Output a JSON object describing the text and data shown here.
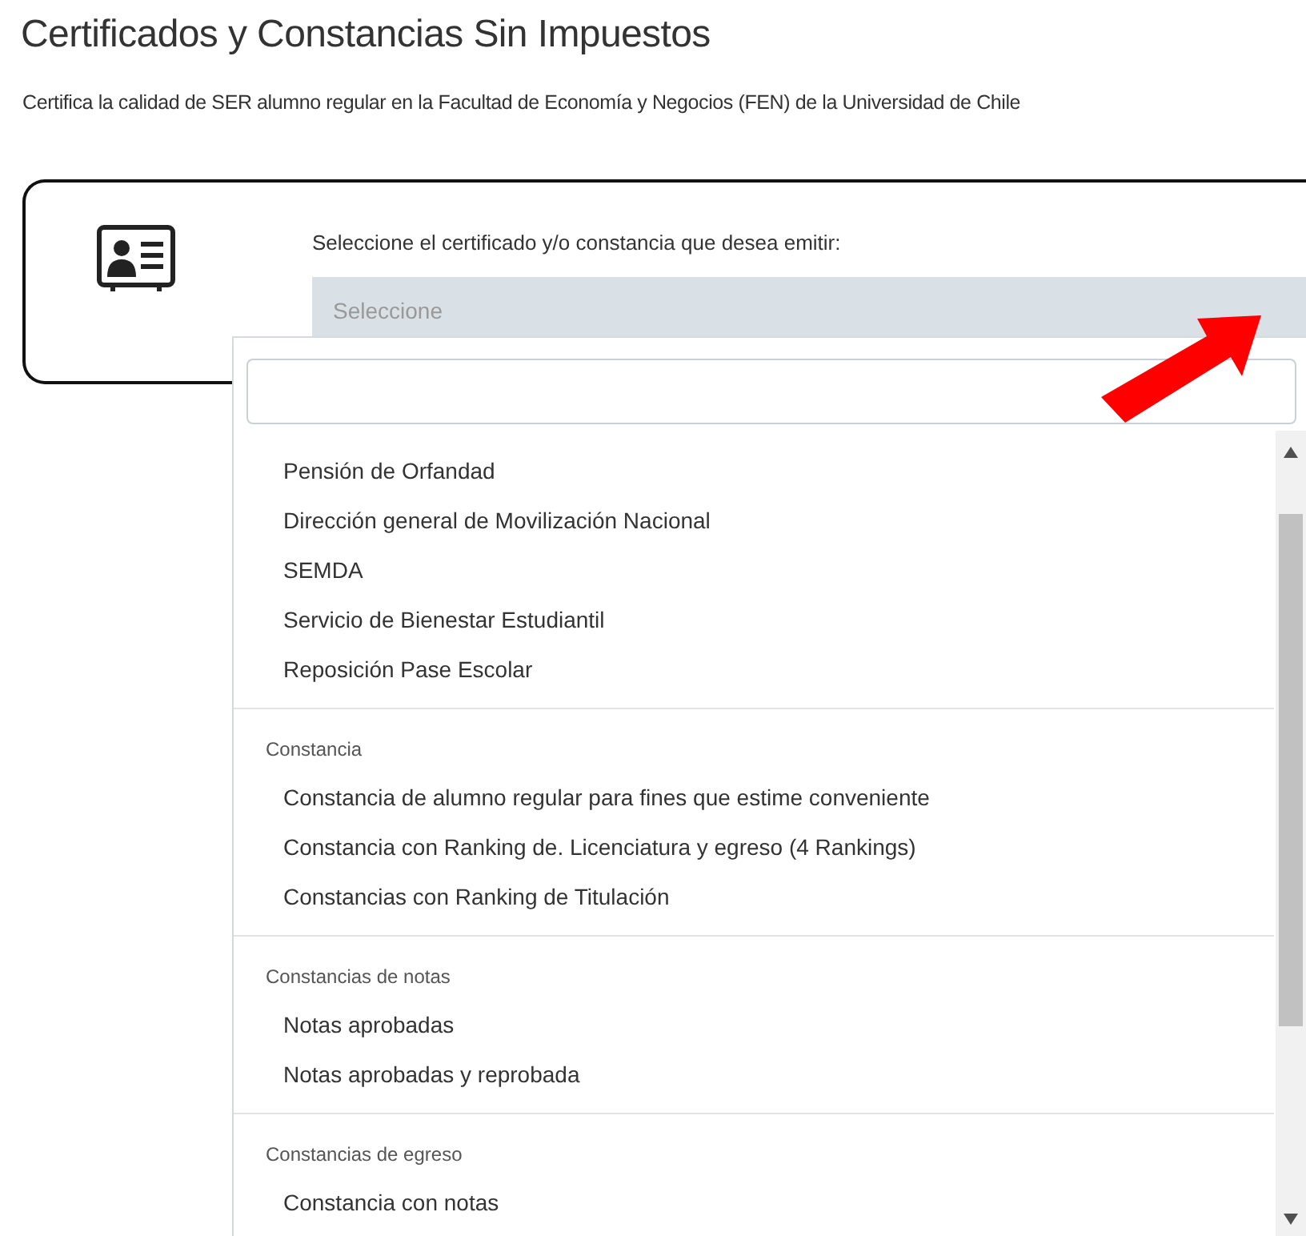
{
  "page": {
    "title": "Certificados y Constancias Sin Impuestos",
    "subtitle": "Certifica la calidad de SER alumno regular en la Facultad de Economía y Negocios (FEN) de la Universidad de Chile"
  },
  "form": {
    "label": "Seleccione el certificado y/o constancia que desea emitir:",
    "select": {
      "placeholder": "Seleccione",
      "expanded": true
    }
  },
  "dropdown": {
    "groups": [
      {
        "items": [
          "Pensión de Orfandad",
          "Dirección general de Movilización Nacional",
          "SEMDA",
          "Servicio de Bienestar Estudiantil",
          "Reposición Pase Escolar"
        ]
      },
      {
        "header": "Constancia",
        "items": [
          "Constancia de alumno regular para fines que estime conveniente",
          "Constancia con Ranking de. Licenciatura y egreso (4 Rankings)",
          "Constancias con Ranking de Titulación"
        ]
      },
      {
        "header": "Constancias de notas",
        "items": [
          "Notas aprobadas",
          "Notas aprobadas y reprobada"
        ]
      },
      {
        "header": "Constancias de egreso",
        "items": [
          "Constancia con notas"
        ]
      }
    ]
  }
}
